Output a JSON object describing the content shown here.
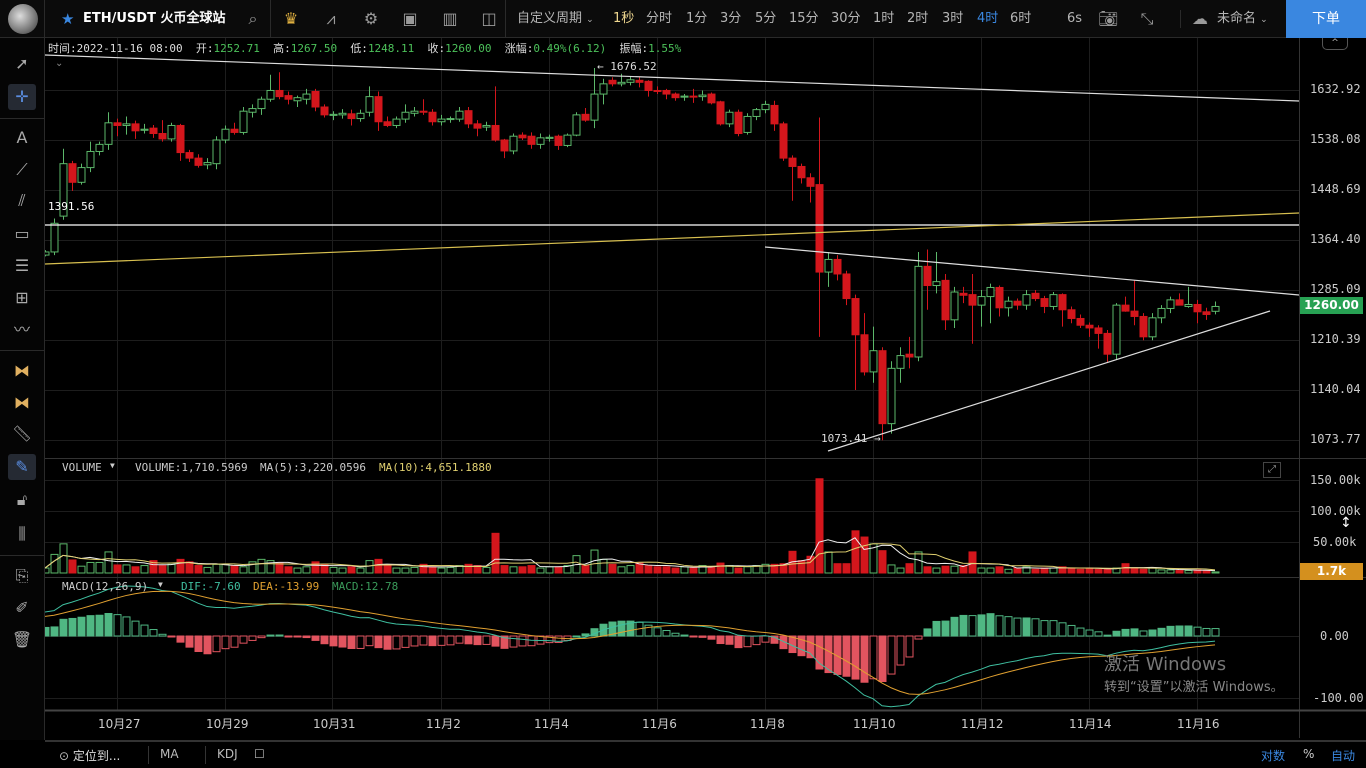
{
  "topbar": {
    "symbol": "ETH/USDT 火币全球站",
    "custom_period": "自定义周期",
    "periods": [
      "1秒",
      "分时",
      "1分",
      "3分",
      "5分",
      "15分",
      "30分",
      "1时",
      "2时",
      "3时",
      "4时",
      "6时"
    ],
    "active_period": "4时",
    "refresh": "6s",
    "layout_name": "未命名",
    "order_button": "下单"
  },
  "info": {
    "time_label": "时间:",
    "time": "2022-11-16 08:00",
    "open_label": "开:",
    "open": "1252.71",
    "high_label": "高:",
    "high": "1267.50",
    "low_label": "低:",
    "low": "1248.11",
    "close_label": "收:",
    "close": "1260.00",
    "change_label": "涨幅:",
    "change": "0.49%(6.12)",
    "amp_label": "振幅:",
    "amp": "1.55%"
  },
  "annotations": {
    "h_line": "1391.56",
    "max": "← 1676.52",
    "min": "1073.41 →"
  },
  "price_axis": [
    "1632.92",
    "1538.08",
    "1448.69",
    "1364.40",
    "1285.09",
    "1210.39",
    "1140.04",
    "1073.77"
  ],
  "last_price": "1260.00",
  "volume": {
    "name": "VOLUME",
    "value": "VOLUME:1,710.5969",
    "ma5": "MA(5):3,220.0596",
    "ma10": "MA(10):4,651.1880",
    "axis": [
      "150.00k",
      "100.00k",
      "50.00k"
    ],
    "last": "1.7k"
  },
  "macd": {
    "name": "MACD(12,26,9)",
    "dif": "DIF:-7.60",
    "dea": "DEA:-13.99",
    "macd": "MACD:12.78",
    "axis": [
      "0.00",
      "-100.00"
    ]
  },
  "time_axis": [
    "10月27",
    "10月29",
    "10月31",
    "11月2",
    "11月4",
    "11月6",
    "11月8",
    "11月10",
    "11月12",
    "11月14",
    "11月16"
  ],
  "bottombar": {
    "locate": "定位到...",
    "ma": "MA",
    "kdj": "KDJ",
    "log": "对数",
    "percent": "%",
    "auto": "自动"
  },
  "watermark": {
    "line1": "激活 Windows",
    "line2": "转到“设置”以激活 Windows。"
  },
  "colors": {
    "up": "#5cb86a",
    "down": "#d4161c",
    "accent": "#3a87e0",
    "last_badge": "#27a153",
    "vol_badge": "#d4901e",
    "dif": "#3fbfa0",
    "dea": "#e0a030"
  },
  "chart_data": {
    "type": "candlestick",
    "interval": "4时",
    "ohlc": [
      [
        1340,
        1348,
        1338,
        1345
      ],
      [
        1345,
        1400,
        1340,
        1392
      ],
      [
        1404,
        1522,
        1398,
        1495
      ],
      [
        1495,
        1500,
        1447,
        1462
      ],
      [
        1462,
        1495,
        1458,
        1488
      ],
      [
        1488,
        1535,
        1480,
        1517
      ],
      [
        1517,
        1535,
        1510,
        1530
      ],
      [
        1530,
        1590,
        1520,
        1570
      ],
      [
        1570,
        1578,
        1545,
        1565
      ],
      [
        1565,
        1582,
        1548,
        1568
      ],
      [
        1568,
        1574,
        1540,
        1555
      ],
      [
        1556,
        1568,
        1550,
        1558
      ],
      [
        1560,
        1566,
        1542,
        1550
      ],
      [
        1550,
        1575,
        1535,
        1540
      ],
      [
        1540,
        1570,
        1535,
        1565
      ],
      [
        1565,
        1568,
        1500,
        1515
      ],
      [
        1515,
        1520,
        1498,
        1505
      ],
      [
        1505,
        1512,
        1488,
        1492
      ],
      [
        1493,
        1505,
        1485,
        1497
      ],
      [
        1495,
        1545,
        1485,
        1538
      ],
      [
        1538,
        1565,
        1532,
        1558
      ],
      [
        1558,
        1570,
        1548,
        1552
      ],
      [
        1552,
        1600,
        1548,
        1592
      ],
      [
        1590,
        1605,
        1580,
        1597
      ],
      [
        1597,
        1620,
        1585,
        1615
      ],
      [
        1615,
        1663,
        1610,
        1632
      ],
      [
        1632,
        1668,
        1615,
        1620
      ],
      [
        1622,
        1630,
        1605,
        1615
      ],
      [
        1612,
        1622,
        1600,
        1618
      ],
      [
        1615,
        1635,
        1605,
        1625
      ],
      [
        1630,
        1635,
        1592,
        1600
      ],
      [
        1600,
        1605,
        1580,
        1585
      ],
      [
        1584,
        1592,
        1575,
        1586
      ],
      [
        1585,
        1596,
        1578,
        1588
      ],
      [
        1587,
        1595,
        1565,
        1578
      ],
      [
        1578,
        1595,
        1572,
        1588
      ],
      [
        1590,
        1640,
        1582,
        1620
      ],
      [
        1620,
        1630,
        1555,
        1572
      ],
      [
        1572,
        1582,
        1562,
        1565
      ],
      [
        1565,
        1582,
        1560,
        1577
      ],
      [
        1577,
        1605,
        1570,
        1590
      ],
      [
        1588,
        1600,
        1582,
        1592
      ],
      [
        1592,
        1615,
        1585,
        1590
      ],
      [
        1590,
        1596,
        1565,
        1572
      ],
      [
        1572,
        1585,
        1565,
        1577
      ],
      [
        1577,
        1582,
        1570,
        1578
      ],
      [
        1577,
        1600,
        1572,
        1592
      ],
      [
        1593,
        1600,
        1560,
        1568
      ],
      [
        1568,
        1575,
        1545,
        1560
      ],
      [
        1562,
        1572,
        1555,
        1565
      ],
      [
        1565,
        1640,
        1535,
        1538
      ],
      [
        1538,
        1540,
        1505,
        1518
      ],
      [
        1518,
        1550,
        1512,
        1545
      ],
      [
        1547,
        1552,
        1538,
        1542
      ],
      [
        1545,
        1552,
        1522,
        1530
      ],
      [
        1530,
        1550,
        1522,
        1542
      ],
      [
        1541,
        1548,
        1535,
        1543
      ],
      [
        1545,
        1548,
        1520,
        1528
      ],
      [
        1528,
        1550,
        1525,
        1547
      ],
      [
        1547,
        1590,
        1545,
        1585
      ],
      [
        1586,
        1598,
        1572,
        1575
      ],
      [
        1575,
        1676.52,
        1560,
        1625
      ],
      [
        1625,
        1655,
        1605,
        1645
      ],
      [
        1652,
        1658,
        1640,
        1645
      ],
      [
        1645,
        1665,
        1640,
        1648
      ],
      [
        1648,
        1660,
        1642,
        1653
      ],
      [
        1652,
        1658,
        1638,
        1648
      ],
      [
        1650,
        1652,
        1620,
        1632
      ],
      [
        1632,
        1640,
        1625,
        1631
      ],
      [
        1632,
        1635,
        1615,
        1625
      ],
      [
        1625,
        1628,
        1612,
        1618
      ],
      [
        1619,
        1625,
        1612,
        1621
      ],
      [
        1621,
        1635,
        1608,
        1620
      ],
      [
        1620,
        1632,
        1612,
        1623
      ],
      [
        1625,
        1628,
        1605,
        1608
      ],
      [
        1610,
        1612,
        1565,
        1568
      ],
      [
        1568,
        1595,
        1562,
        1590
      ],
      [
        1590,
        1595,
        1545,
        1550
      ],
      [
        1552,
        1588,
        1548,
        1582
      ],
      [
        1582,
        1598,
        1575,
        1595
      ],
      [
        1595,
        1612,
        1588,
        1605
      ],
      [
        1603,
        1612,
        1555,
        1568
      ],
      [
        1568,
        1572,
        1500,
        1505
      ],
      [
        1505,
        1510,
        1430,
        1490
      ],
      [
        1490,
        1495,
        1460,
        1470
      ],
      [
        1470,
        1478,
        1427,
        1455
      ],
      [
        1458,
        1580,
        1215,
        1313
      ],
      [
        1313,
        1345,
        1290,
        1333
      ],
      [
        1333,
        1340,
        1300,
        1310
      ],
      [
        1310,
        1315,
        1262,
        1272
      ],
      [
        1272,
        1278,
        1140,
        1218
      ],
      [
        1218,
        1250,
        1160,
        1165
      ],
      [
        1165,
        1230,
        1150,
        1195
      ],
      [
        1195,
        1200,
        1073.41,
        1095
      ],
      [
        1095,
        1180,
        1082,
        1170
      ],
      [
        1170,
        1200,
        1150,
        1188
      ],
      [
        1190,
        1215,
        1170,
        1186
      ],
      [
        1186,
        1345,
        1180,
        1322
      ],
      [
        1322,
        1349,
        1255,
        1292
      ],
      [
        1292,
        1345,
        1280,
        1298
      ],
      [
        1300,
        1310,
        1225,
        1240
      ],
      [
        1240,
        1290,
        1228,
        1282
      ],
      [
        1280,
        1290,
        1265,
        1277
      ],
      [
        1278,
        1310,
        1205,
        1262
      ],
      [
        1262,
        1285,
        1230,
        1275
      ],
      [
        1275,
        1295,
        1235,
        1289
      ],
      [
        1289,
        1292,
        1245,
        1258
      ],
      [
        1258,
        1275,
        1245,
        1268
      ],
      [
        1268,
        1272,
        1255,
        1262
      ],
      [
        1262,
        1285,
        1255,
        1278
      ],
      [
        1280,
        1285,
        1268,
        1272
      ],
      [
        1272,
        1276,
        1250,
        1260
      ],
      [
        1260,
        1282,
        1255,
        1278
      ],
      [
        1278,
        1280,
        1230,
        1255
      ],
      [
        1255,
        1260,
        1235,
        1242
      ],
      [
        1242,
        1248,
        1228,
        1232
      ],
      [
        1232,
        1236,
        1215,
        1228
      ],
      [
        1228,
        1232,
        1198,
        1220
      ],
      [
        1220,
        1225,
        1178,
        1190
      ],
      [
        1190,
        1265,
        1182,
        1262
      ],
      [
        1262,
        1275,
        1252,
        1253
      ],
      [
        1253,
        1300,
        1232,
        1245
      ],
      [
        1245,
        1250,
        1210,
        1215
      ],
      [
        1215,
        1250,
        1210,
        1243
      ],
      [
        1243,
        1262,
        1235,
        1257
      ],
      [
        1257,
        1275,
        1250,
        1270
      ],
      [
        1270,
        1280,
        1262,
        1262
      ],
      [
        1260,
        1290,
        1258,
        1263
      ],
      [
        1263,
        1270,
        1235,
        1252
      ],
      [
        1252,
        1258,
        1240,
        1248
      ],
      [
        1252.71,
        1267.5,
        1248.11,
        1260
      ]
    ],
    "volume_k": [
      8,
      30,
      47,
      21,
      11,
      17,
      17,
      34,
      13,
      13,
      10,
      12,
      20,
      12,
      14,
      22,
      18,
      12,
      9,
      14,
      14,
      12,
      10,
      18,
      22,
      20,
      16,
      10,
      8,
      10,
      18,
      14,
      9,
      8,
      10,
      8,
      20,
      22,
      12,
      8,
      8,
      9,
      14,
      10,
      8,
      9,
      12,
      14,
      12,
      9,
      64,
      12,
      10,
      10,
      12,
      8,
      10,
      10,
      12,
      28,
      12,
      37,
      22,
      14,
      10,
      12,
      16,
      12,
      10,
      10,
      8,
      10,
      8,
      12,
      10,
      16,
      12,
      8,
      10,
      12,
      14,
      14,
      15,
      35,
      20,
      27,
      152,
      34,
      15,
      15,
      68,
      58,
      47,
      36,
      13,
      8,
      15,
      34,
      10,
      8,
      11,
      11,
      12,
      34,
      8,
      8,
      10,
      6,
      8,
      10,
      6,
      8,
      8,
      10,
      8,
      6,
      8,
      6,
      6,
      8,
      15,
      8,
      6,
      8,
      5,
      5,
      4,
      4,
      5,
      4,
      1.7
    ],
    "price_scale": "log",
    "ylim": [
      1073.77,
      1632.92
    ]
  }
}
